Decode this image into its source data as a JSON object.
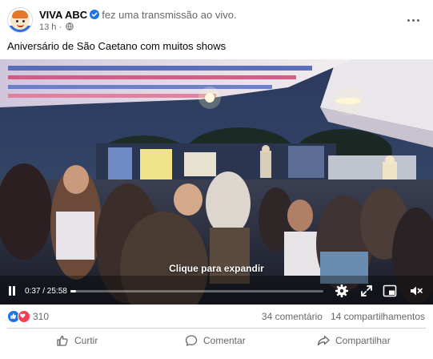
{
  "post": {
    "page_name": "VIVA ABC",
    "action_text": "fez uma transmissão ao vivo.",
    "time_ago": "13 h ·",
    "caption": "Aniversário de São Caetano com muitos shows"
  },
  "video": {
    "expand_hint": "Clique para expandir",
    "current_time": "0:37",
    "duration": "25:58",
    "time_display": "0:37 / 25:58",
    "progress": 0.0237
  },
  "reactions": {
    "count": "310",
    "comments": "34 comentário",
    "shares": "14 compartilhamentos"
  },
  "actions": {
    "like": "Curtir",
    "comment": "Comentar",
    "share": "Compartilhar"
  },
  "colors": {
    "brand_blue": "#1b74e4",
    "love_red": "#f33e58",
    "muted_text": "#65676b"
  }
}
